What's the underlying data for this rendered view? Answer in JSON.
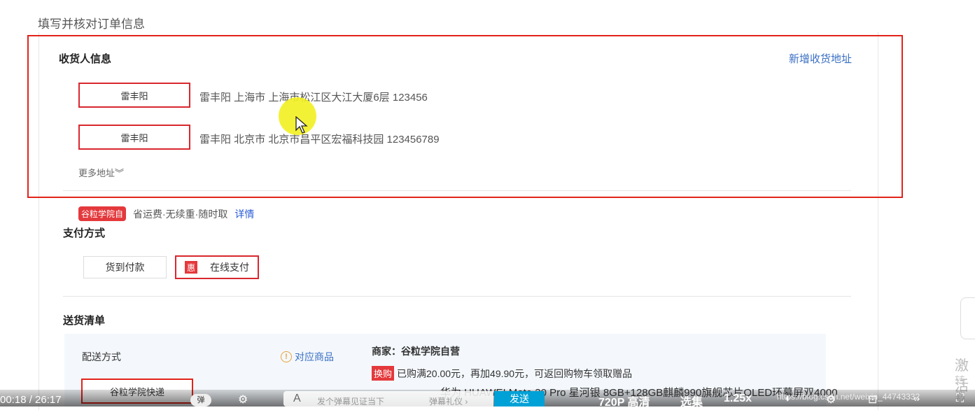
{
  "page_title": "填写并核对订单信息",
  "receiver": {
    "title": "收货人信息",
    "add_link": "新增收货地址",
    "addresses": [
      {
        "name": "雷丰阳",
        "detail": "雷丰阳 上海市 上海市松江区大江大厦6层 123456"
      },
      {
        "name": "雷丰阳",
        "detail": "雷丰阳 北京市 北京市昌平区宏福科技园 123456789"
      }
    ],
    "more": "更多地址︾"
  },
  "promo": {
    "badge": "谷粒学院自",
    "text": "省运费·无续重·随时取",
    "link": "详情"
  },
  "payment": {
    "title": "支付方式",
    "cod": "货到付款",
    "online_tag": "惠",
    "online": "在线支付"
  },
  "delivery": {
    "title": "送货清单",
    "method_label": "配送方式",
    "method_value": "谷粒学院快递",
    "corresponding": "对应商品",
    "seller": "商家：谷粒学院自营",
    "exchange_badge": "换购",
    "exchange_text": "已购满20.00元，再加49.90元，可返回购物车领取赠品",
    "product": "华为 HUAWEI Mate 30 Pro 星河银 8GB+128GB麒麟990旗舰芯片OLED环幕屏双4000"
  },
  "player": {
    "time": "00:18 / 26:17",
    "danmaku_placeholder": "发个弹幕见证当下",
    "danmaku_rule": "弹幕礼仪 ›",
    "send": "发送",
    "quality": "720P 高清",
    "episodes": "选集",
    "speed": "1.25x",
    "watermark": "https://blog.csdn.net/weixin_44743332"
  },
  "side": {
    "text1": "激活",
    "text2": "转到"
  }
}
